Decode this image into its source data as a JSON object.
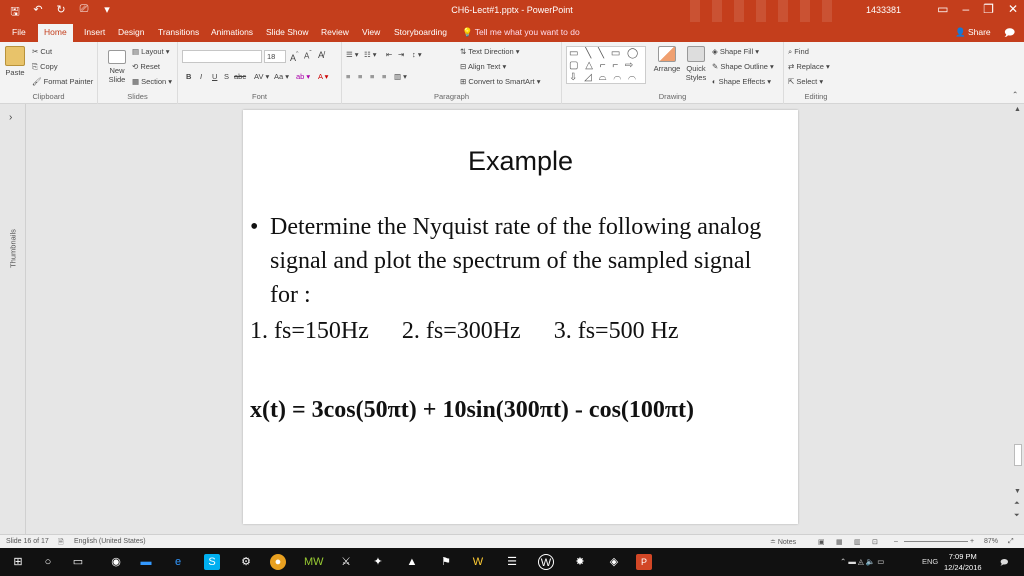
{
  "titlebar": {
    "doc_title": "CH6-Lect#1.pptx - PowerPoint",
    "user": "1433381",
    "qat": {
      "save": "🖫",
      "undo": "↶",
      "redo": "↻",
      "present": "⎚",
      "more": "▾"
    }
  },
  "tabs": [
    "File",
    "Home",
    "Insert",
    "Design",
    "Transitions",
    "Animations",
    "Slide Show",
    "Review",
    "View",
    "Storyboarding"
  ],
  "tell_me": "Tell me what you want to do",
  "share": "Share",
  "ribbon": {
    "clipboard": {
      "paste": "Paste",
      "cut": "Cut",
      "copy": "Copy",
      "format_painter": "Format Painter",
      "label": "Clipboard"
    },
    "slides": {
      "new_slide": "New Slide",
      "layout": "Layout",
      "reset": "Reset",
      "section": "Section",
      "label": "Slides"
    },
    "font": {
      "size": "18",
      "label": "Font",
      "bold": "B",
      "italic": "I",
      "underline": "U",
      "shadow": "S",
      "strike": "abc"
    },
    "paragraph": {
      "text_direction": "Text Direction",
      "align_text": "Align Text",
      "convert_smartart": "Convert to SmartArt",
      "label": "Paragraph"
    },
    "drawing": {
      "arrange": "Arrange",
      "quick_styles": "Quick Styles",
      "shape_fill": "Shape Fill",
      "shape_outline": "Shape Outline",
      "shape_effects": "Shape Effects",
      "label": "Drawing",
      "shapes_glyphs": "▭ ╲ ╲ ▭ ◯ ▢ △ ⌐ ⌐ ⇨ ⇩ ◿ ⌓ ⌒ ⌒ { } ☆"
    },
    "editing": {
      "find": "Find",
      "replace": "Replace",
      "select": "Select",
      "label": "Editing"
    }
  },
  "thumbnails_label": "Thumbnails",
  "slide": {
    "title": "Example",
    "bullet": "Determine the Nyquist rate of the following analog signal and plot the spectrum of the sampled signal for :",
    "items": [
      "1. fs=150Hz",
      "2. fs=300Hz",
      "3. fs=500 Hz"
    ],
    "formula": "x(t) = 3cos(50πt) + 10sin(300πt) - cos(100πt)"
  },
  "status": {
    "slide_of": "Slide 16 of 17",
    "language": "English (United States)",
    "notes": "Notes",
    "zoom": "87%"
  },
  "taskbar": {
    "time": "7:09 PM",
    "date": "12/24/2016",
    "lang": "ENG"
  },
  "colors": {
    "accent": "#c43e1c",
    "ribbon": "#f3f3f3",
    "taskbar": "#111111"
  }
}
